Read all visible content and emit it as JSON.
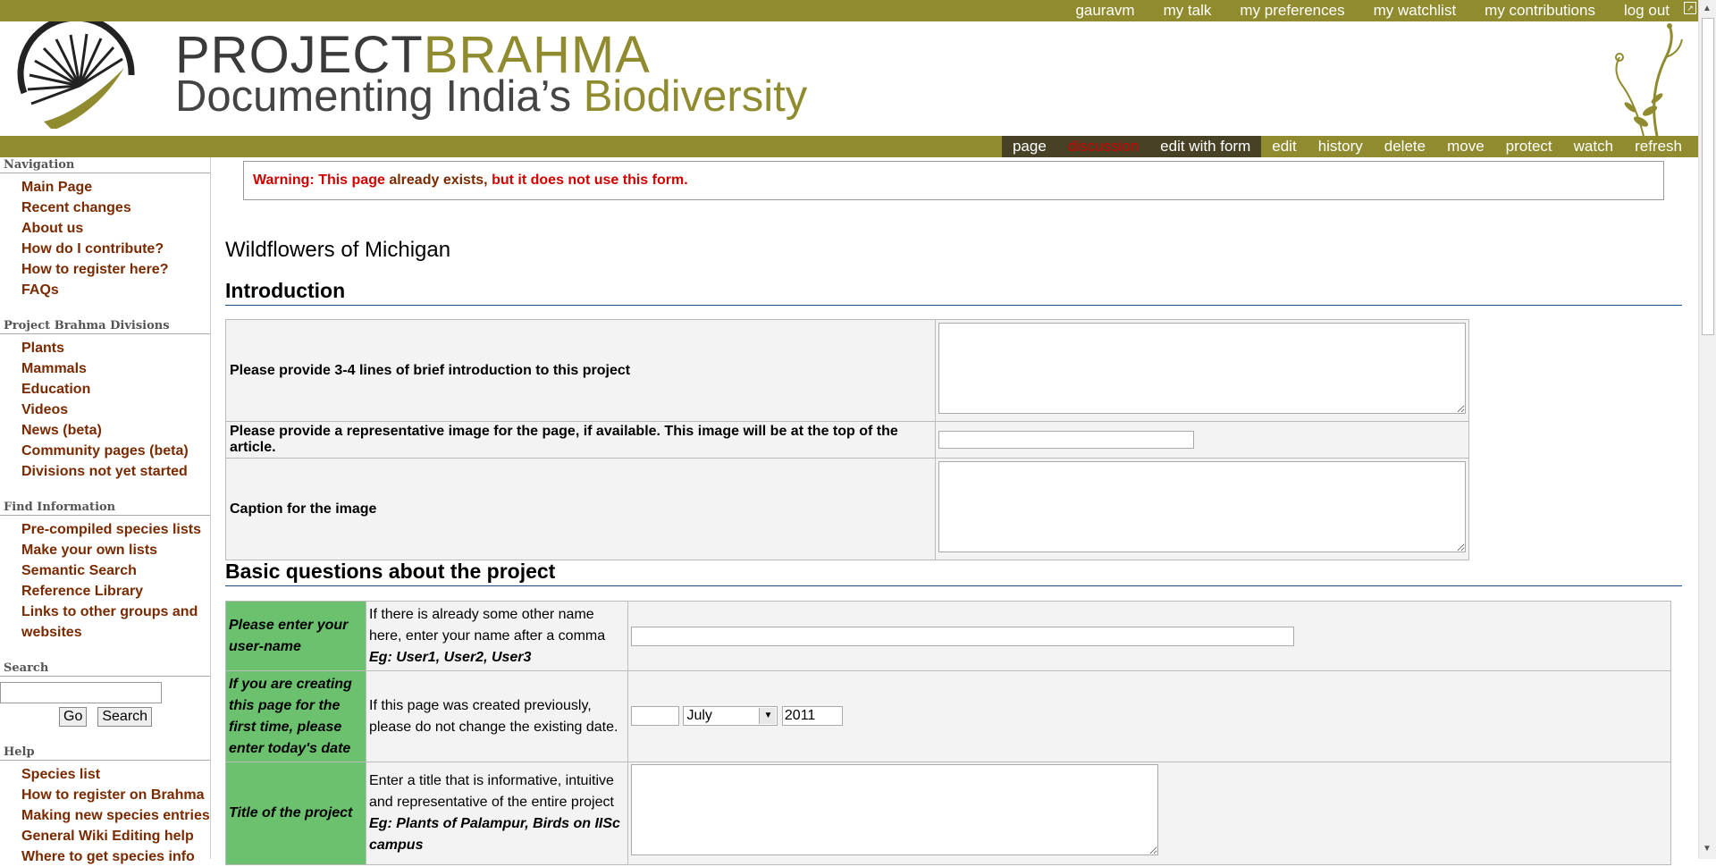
{
  "personal_links": [
    "gauravm",
    "my talk",
    "my preferences",
    "my watchlist",
    "my contributions",
    "log out"
  ],
  "brand": {
    "title_part1": "PROJECT",
    "title_part2": "BRAHMA",
    "subtitle_part1": "Documenting India’s ",
    "subtitle_part2": "Biodiversity"
  },
  "tabs": [
    "page",
    "discussion",
    "edit with form",
    "edit",
    "history",
    "delete",
    "move",
    "protect",
    "watch",
    "refresh"
  ],
  "sidebar": {
    "navigation": {
      "title": "Navigation",
      "items": [
        "Main Page",
        "Recent changes",
        "About us",
        "How do I contribute?",
        "How to register here?",
        "FAQs"
      ]
    },
    "divisions": {
      "title": "Project Brahma Divisions",
      "items": [
        "Plants",
        "Mammals",
        "Education",
        "Videos",
        "News (beta)",
        "Community pages (beta)",
        "Divisions not yet started"
      ]
    },
    "find": {
      "title": "Find Information",
      "items": [
        "Pre-compiled species lists",
        "Make your own lists",
        "Semantic Search",
        "Reference Library",
        "Links to other groups and",
        "websites"
      ]
    },
    "search": {
      "title": "Search",
      "go": "Go",
      "search": "Search"
    },
    "help": {
      "title": "Help",
      "items": [
        "Species list",
        "How to register on Brahma",
        "Making new species entries",
        "General Wiki Editing help",
        "Where to get species info"
      ]
    }
  },
  "warning": {
    "label": "Warning:",
    "link": "This page",
    "middle": "already exists,",
    "end": "but it does not use this form."
  },
  "page_title": "Wildflowers of Michigan",
  "intro": {
    "heading": "Introduction",
    "rows": [
      "Please provide 3-4 lines of brief introduction to this project",
      "Please provide a representative image for the page, if available. This image will be at the top of the article.",
      "Caption for the image"
    ]
  },
  "basic": {
    "heading": "Basic questions about the project",
    "rows": [
      {
        "question": "Please enter your user-name",
        "help": "If there is already some other name here, enter your name after a comma",
        "example": "Eg: User1, User2, User3"
      },
      {
        "question": "If you are creating this page for the first time, please enter today's date",
        "help": "If this page was created previously, please do not change the existing date.",
        "month": "July",
        "year": "2011"
      },
      {
        "question": "Title of the project",
        "help": "Enter a title that is informative, intuitive and representative of the entire project",
        "example": "Eg: Plants of Palampur, Birds on IISc campus"
      }
    ]
  },
  "colors": {
    "bar": "#8f8b2e",
    "tab_dark": "#474225",
    "question_bg": "#6cc16f",
    "link": "#7a2a00",
    "warning": "#d00000"
  }
}
